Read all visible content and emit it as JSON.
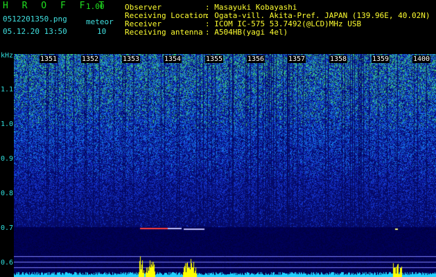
{
  "header": {
    "app_name": "H R O F F T",
    "version": "1.00",
    "filename": "0512201350.png",
    "mode": "meteor",
    "datetime": "05.12.20 13:50",
    "count": "10",
    "fields": [
      {
        "label": "Observer",
        "value": ": Masayuki Kobayashi"
      },
      {
        "label": "Receiving Location",
        "value": ": Ogata-vill. Akita-Pref. JAPAN (139.96E, 40.02N)"
      },
      {
        "label": "Receiver",
        "value": ": ICOM IC-575 53.7492(@LCD)MHz USB"
      },
      {
        "label": "Receiving antenna",
        "value": ": A504HB(yagi 4el)"
      }
    ]
  },
  "axis": {
    "unit": "kHz",
    "y_labels": [
      "1.1",
      "1.0",
      "0.9",
      "0.8",
      "0.7",
      "0.6"
    ],
    "time_labels": [
      "1351",
      "1352",
      "1353",
      "1354",
      "1355",
      "1356",
      "1357",
      "1358",
      "1359",
      "1400"
    ]
  },
  "colors": {
    "background": "#000000",
    "header_green": "#20e020",
    "header_yellow": "#ffff30",
    "axis_cyan": "#30e0e0",
    "meteor_yellow": "#ffff00"
  }
}
